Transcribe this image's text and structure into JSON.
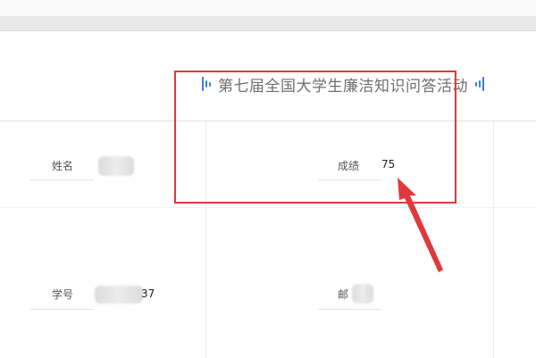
{
  "header": {
    "title": "第七届全国大学生廉洁知识问答活动"
  },
  "form": {
    "name_label": "姓名",
    "score_label": "成绩",
    "score_value": "75",
    "student_id_label": "学号",
    "student_id_partial": "37",
    "email_label": "邮"
  },
  "colors": {
    "accent": "#3b7dde",
    "highlight": "#e0393c"
  }
}
